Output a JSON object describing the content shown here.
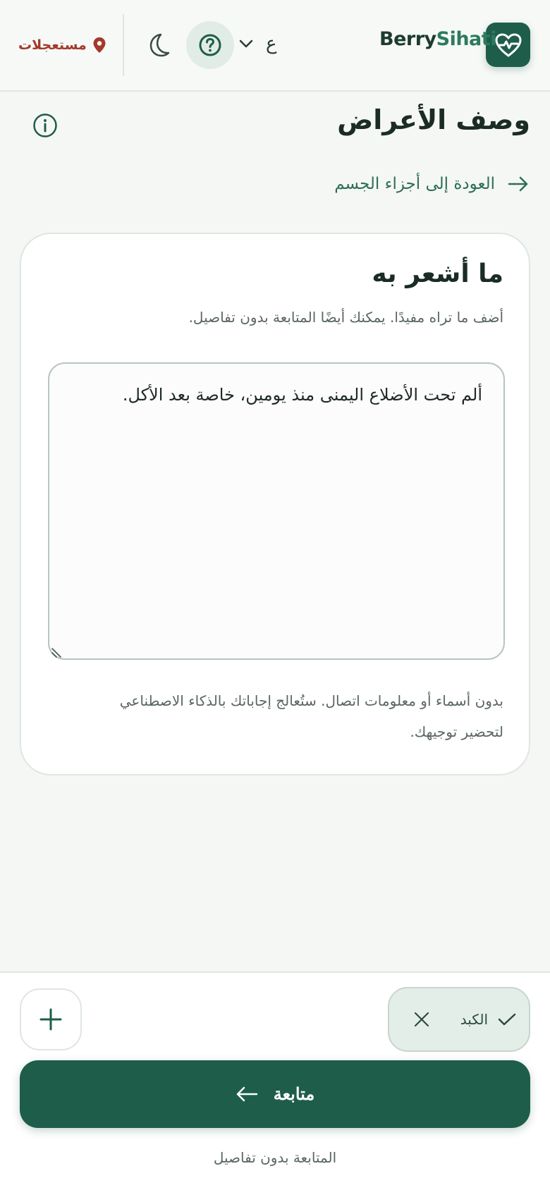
{
  "header": {
    "brand_part1": "Berry",
    "brand_part2": "Sihati",
    "language": "ع",
    "urgent_label": "مستعجلات"
  },
  "page": {
    "title": "وصف الأعراض",
    "back_label": "العودة إلى أجزاء الجسم"
  },
  "card": {
    "title": "ما أشعر به",
    "subtitle": "أضف ما تراه مفيدًا. يمكنك أيضًا المتابعة بدون تفاصيل.",
    "textarea_value": "ألم تحت الأضلاع اليمنى منذ يومين، خاصة بعد الأكل.",
    "note": "بدون أسماء أو معلومات اتصال. ستُعالج إجاباتك بالذكاء الاصطناعي لتحضير توجيهك."
  },
  "bottom": {
    "chip_label": "الكبد",
    "continue_label": "متابعة",
    "skip_label": "المتابعة بدون تفاصيل"
  },
  "colors": {
    "primary": "#1e5d4a",
    "urgent": "#a33a2c",
    "background": "#f5f7f5"
  },
  "icons": [
    "heart-pulse-icon",
    "chevron-down-icon",
    "help-icon",
    "moon-icon",
    "location-pin-icon",
    "info-icon",
    "arrow-right-icon",
    "plus-icon",
    "check-icon",
    "close-icon",
    "arrow-left-icon"
  ]
}
